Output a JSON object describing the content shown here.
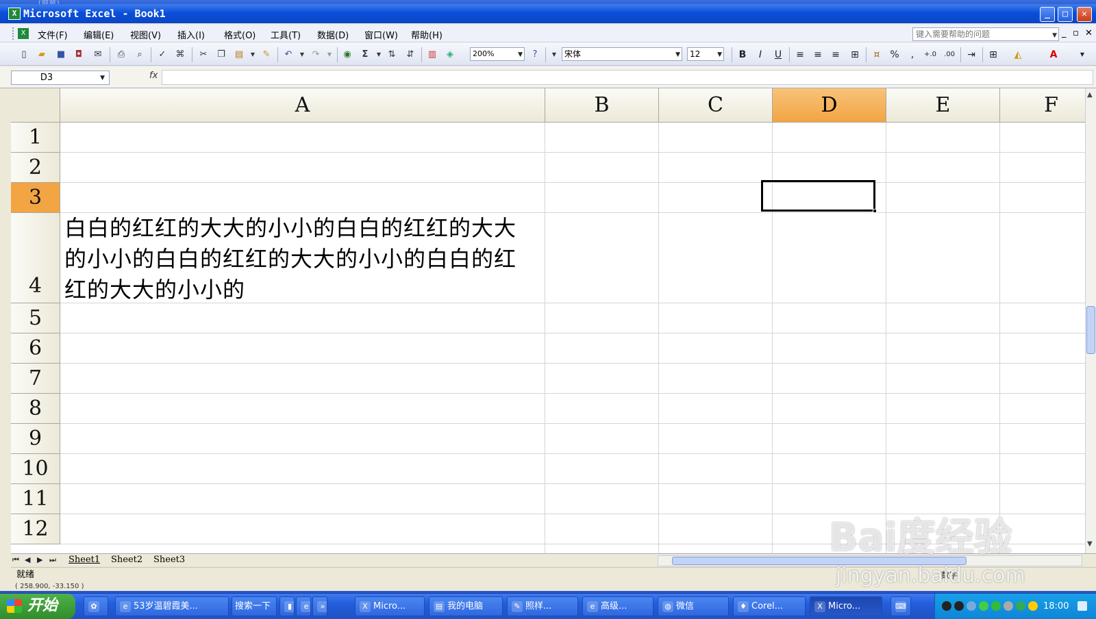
{
  "background_window_title": "...  ...  [屏幕]",
  "window": {
    "title": "Microsoft Excel - Book1",
    "minimize": "_",
    "maximize": "□",
    "close": "✕"
  },
  "menu": {
    "items": [
      "文件(F)",
      "编辑(E)",
      "视图(V)",
      "插入(I)",
      "格式(O)",
      "工具(T)",
      "数据(D)",
      "窗口(W)",
      "帮助(H)"
    ],
    "help_placeholder": "键入需要帮助的问题"
  },
  "toolbar": {
    "zoom": "200%",
    "font": "宋体",
    "size": "12",
    "bold": "B",
    "italic": "I",
    "underline": "U",
    "percent": "%",
    "comma": ",",
    "font_color_label": "A",
    "sum": "Σ"
  },
  "formula_bar": {
    "name_box": "D3",
    "fx": "fx",
    "value": ""
  },
  "grid": {
    "columns": [
      "A",
      "B",
      "C",
      "D",
      "E",
      "F"
    ],
    "selected_column": "D",
    "rows": [
      "1",
      "2",
      "3",
      "4",
      "5",
      "6",
      "7",
      "8",
      "9",
      "10",
      "11",
      "12"
    ],
    "selected_row": "3",
    "cell_A4": "白白的红红的大大的小小的白白的红红的大大的小小的白白的红红的大大的小小的白白的红红的大大的小小的"
  },
  "sheets": [
    "Sheet1",
    "Sheet2",
    "Sheet3"
  ],
  "active_sheet": "Sheet1",
  "status": {
    "ready": "就绪",
    "num": "数字",
    "coords": "( 258.900, -33.150 )"
  },
  "taskbar": {
    "start": "开始",
    "items": [
      "53岁温碧霞美...",
      "搜索一下",
      "Micro...",
      "我的电脑",
      "照样...",
      "高级...",
      "微信",
      "Corel...",
      "Micro..."
    ],
    "clock": "18:00"
  },
  "watermark": {
    "logo": "Bai度经验",
    "url": "jingyan.baidu.com"
  }
}
